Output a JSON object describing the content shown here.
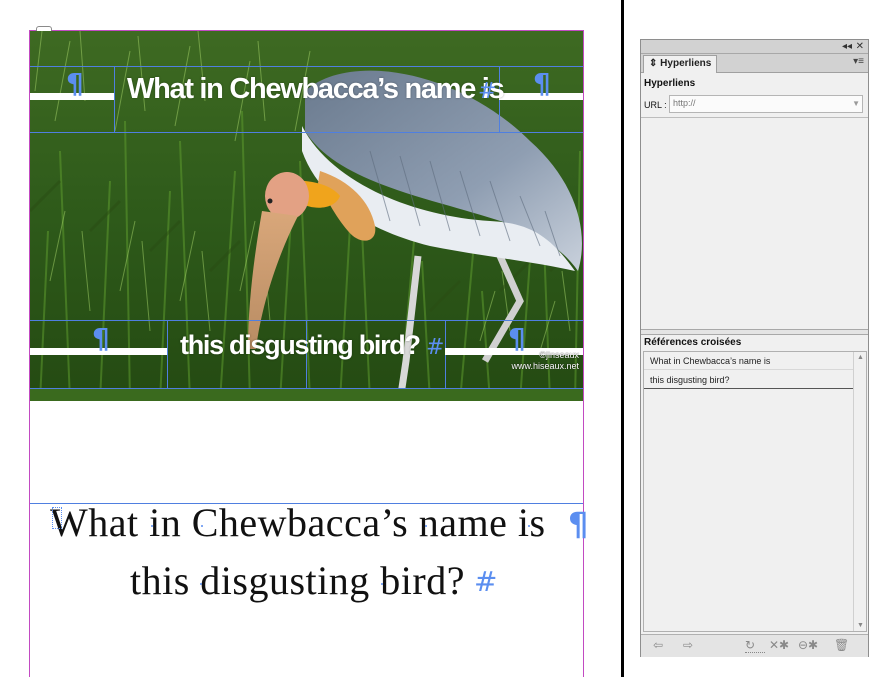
{
  "document": {
    "headline_line1": "What in Chewbacca’s name is",
    "headline_line2": "this disgusting bird?",
    "body_line1": "What in Chewbacca’s name is",
    "body_line2": "this disgusting bird?",
    "paragraph_mark": "¶",
    "story_end_mark": "#",
    "photo_credit_line1": "©jinseaux",
    "photo_credit_line2": "www.hiseaux.net"
  },
  "panel": {
    "tab_label": "Hyperliens",
    "collapse_glyph": "◂◂",
    "close_glyph": "✕",
    "menu_glyph": "▾≡",
    "section_title": "Hyperliens",
    "url_label": "URL :",
    "url_placeholder": "http://",
    "cross_refs_title": "Références croisées",
    "cross_refs": [
      "What in Chewbacca’s name is",
      "this disgusting bird?"
    ],
    "footer_icons": [
      "arrow-left-icon",
      "arrow-right-icon",
      "refresh-icon",
      "tools-icon",
      "link-chain-icon",
      "trash-icon"
    ]
  },
  "colors": {
    "guide_magenta": "#c24ac2",
    "frame_blue": "#4f7fe0",
    "hidden_char_blue": "#5b8ef0"
  }
}
